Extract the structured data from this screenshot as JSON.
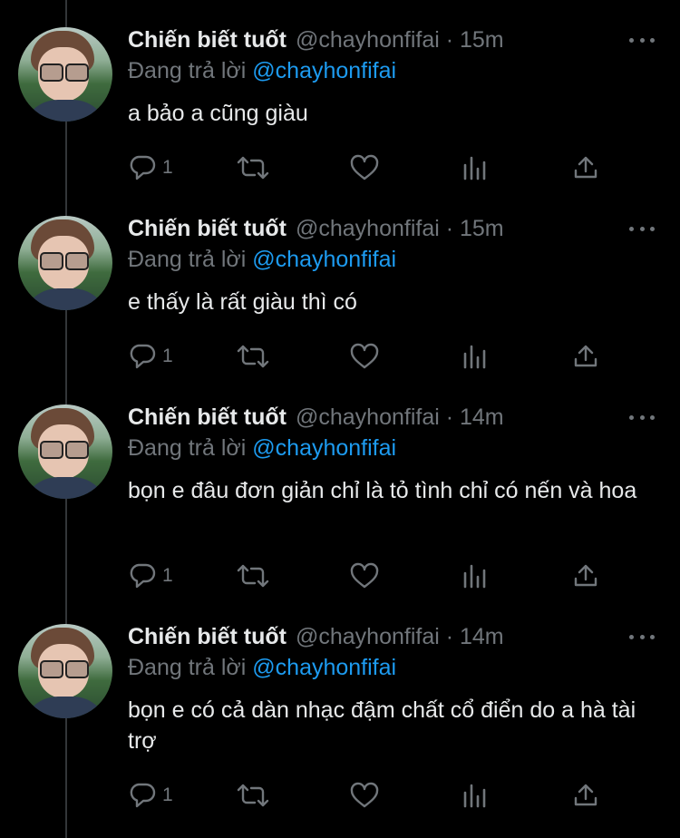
{
  "tweets": [
    {
      "name": "Chiến biết tuốt",
      "meta": "@chayhonfifai · 15m",
      "reply_prefix": "Đang trả lời ",
      "reply_to": "@chayhonfifai",
      "text": "a bảo a cũng giàu",
      "reply_count": "1"
    },
    {
      "name": "Chiến biết tuốt",
      "meta": "@chayhonfifai · 15m",
      "reply_prefix": "Đang trả lời ",
      "reply_to": "@chayhonfifai",
      "text": "e thấy là rất giàu thì có",
      "reply_count": "1"
    },
    {
      "name": "Chiến biết tuốt",
      "meta": "@chayhonfifai · 14m",
      "reply_prefix": "Đang trả lời ",
      "reply_to": "@chayhonfifai",
      "text": "bọn e đâu đơn giản chỉ là tỏ tình chỉ có nến và hoa",
      "reply_count": "1"
    },
    {
      "name": "Chiến biết tuốt",
      "meta": "@chayhonfifai · 14m",
      "reply_prefix": "Đang trả lời ",
      "reply_to": "@chayhonfifai",
      "text": "bọn e có cả dàn nhạc đậm chất cổ điển do a hà tài trợ",
      "reply_count": "1"
    }
  ],
  "icons": {
    "reply": "reply-icon",
    "retweet": "retweet-icon",
    "like": "heart-icon",
    "analytics": "analytics-icon",
    "share": "share-icon",
    "more": "more-icon"
  },
  "colors": {
    "background": "#000000",
    "text": "#e7e9ea",
    "muted": "#71767b",
    "link": "#1d9bf0"
  }
}
